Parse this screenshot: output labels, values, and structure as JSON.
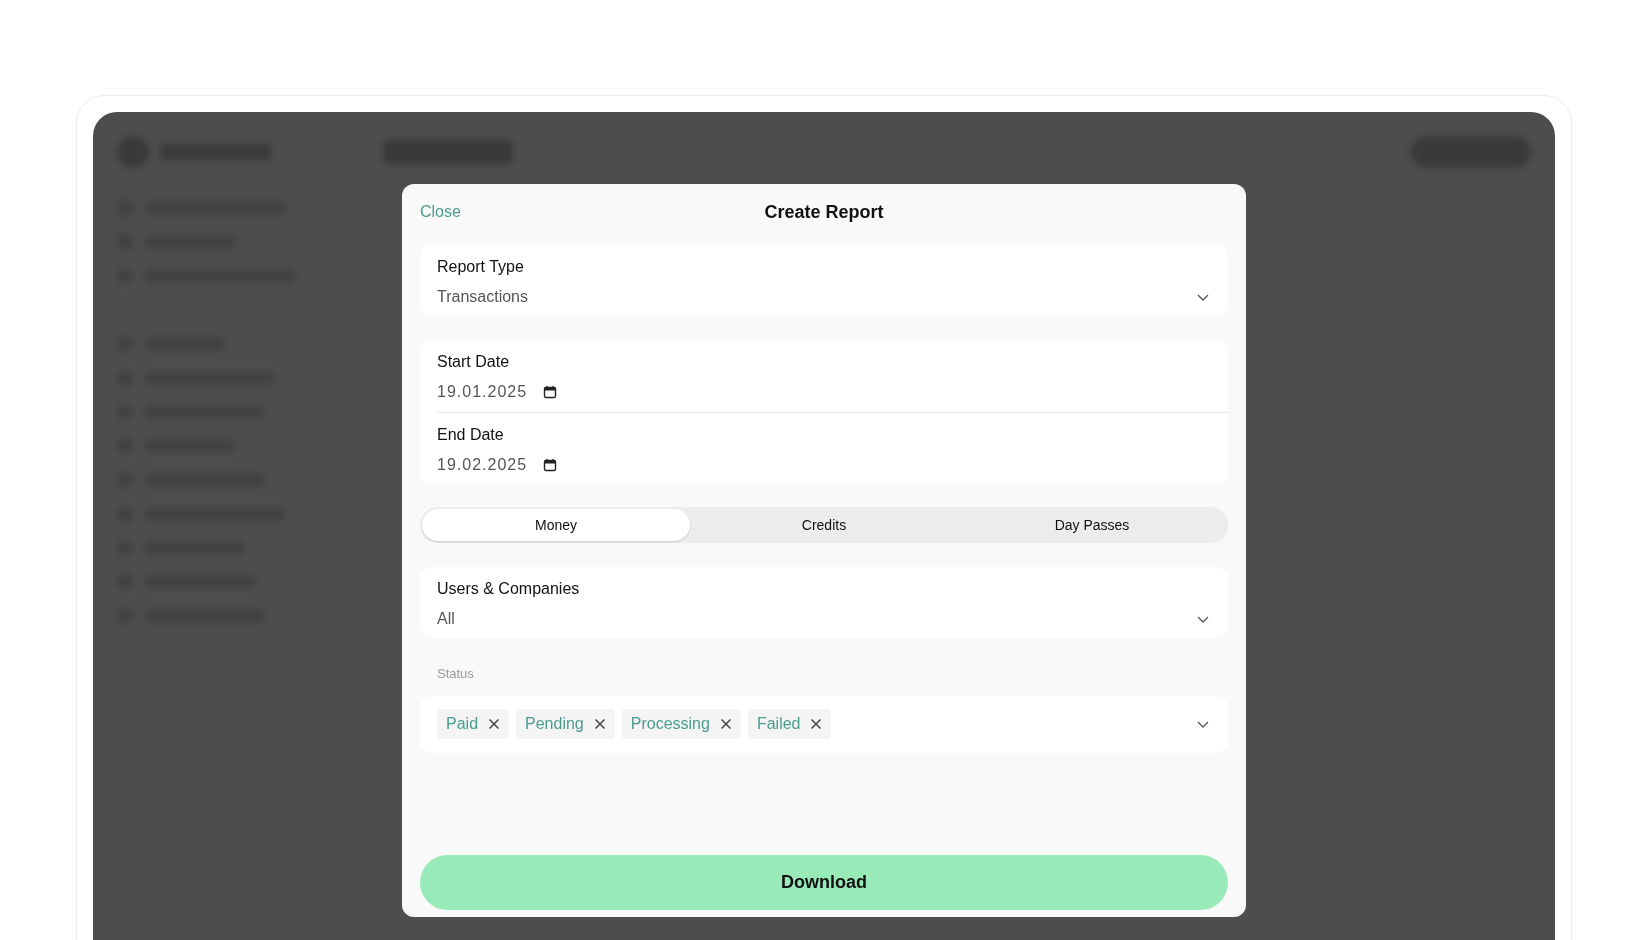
{
  "dialog": {
    "close": "Close",
    "title": "Create Report"
  },
  "report_type": {
    "label": "Report Type",
    "value": "Transactions"
  },
  "dates": [
    {
      "label": "Start Date",
      "value": "19.01.2025"
    },
    {
      "label": "End Date",
      "value": "19.02.2025"
    }
  ],
  "tabs": [
    {
      "label": "Money",
      "selected": true
    },
    {
      "label": "Credits",
      "selected": false
    },
    {
      "label": "Day Passes",
      "selected": false
    }
  ],
  "users": {
    "label": "Users & Companies",
    "value": "All"
  },
  "status": {
    "label": "Status",
    "tags": [
      {
        "label": "Paid"
      },
      {
        "label": "Pending"
      },
      {
        "label": "Processing"
      },
      {
        "label": "Failed"
      }
    ]
  },
  "download": "Download"
}
